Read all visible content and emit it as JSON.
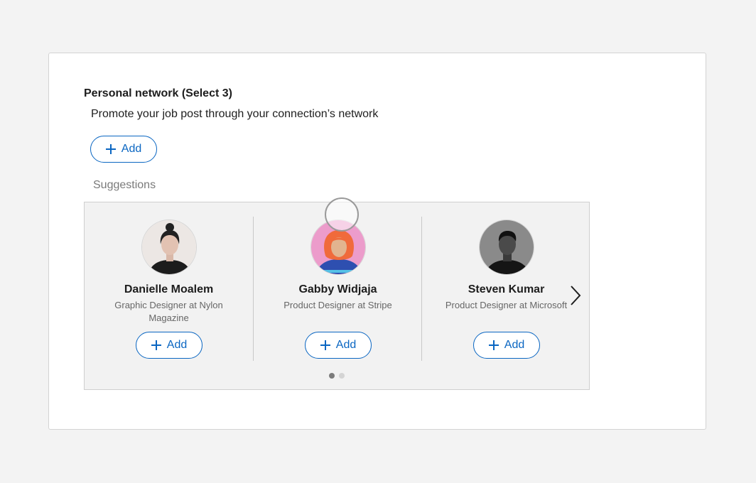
{
  "section": {
    "title": "Personal network (Select 3)",
    "subtitle": "Promote your job post through your connection’s network",
    "add_label": "Add"
  },
  "suggestions": {
    "label": "Suggestions",
    "people": [
      {
        "name": "Danielle Moalem",
        "title": "Graphic Designer at Nylon Magazine",
        "add_label": "Add"
      },
      {
        "name": "Gabby Widjaja",
        "title": "Product Designer at Stripe",
        "add_label": "Add"
      },
      {
        "name": "Steven Kumar",
        "title": "Product Designer at Microsoft",
        "add_label": "Add"
      }
    ],
    "pagination": {
      "pages": 2,
      "current": 1
    }
  },
  "icons": [
    "plus-icon",
    "chevron-right-icon"
  ],
  "colors": {
    "accent": "#0a66c2",
    "muted_text": "#666666",
    "panel_bg": "#f2f2f2"
  }
}
